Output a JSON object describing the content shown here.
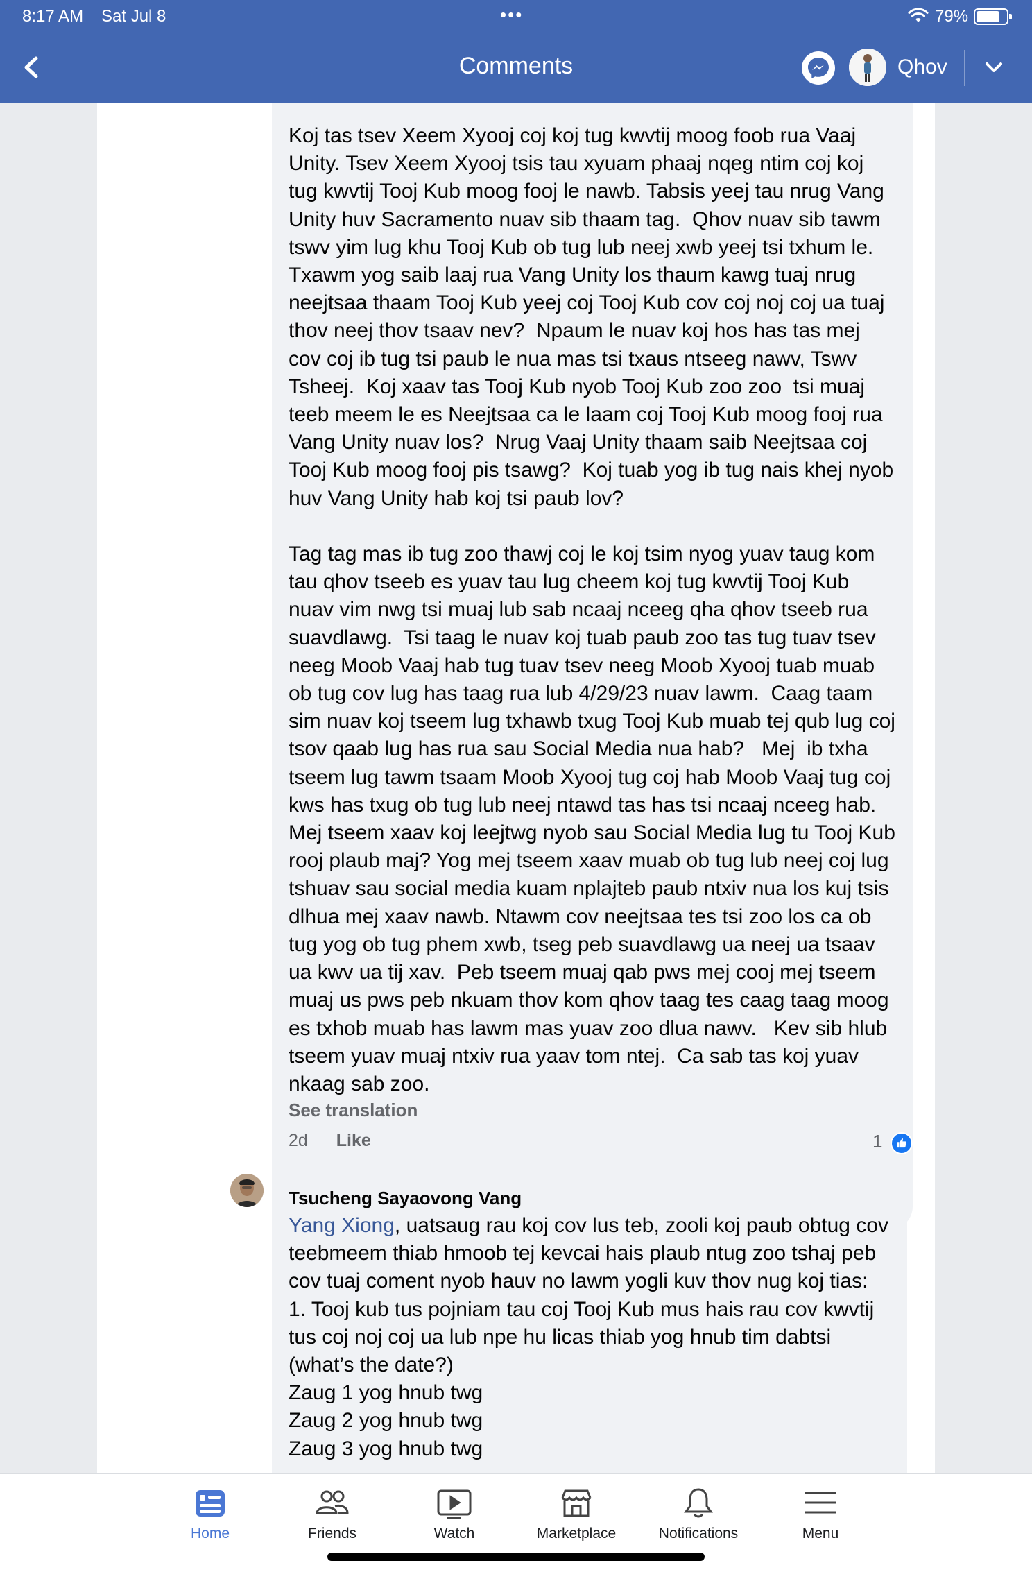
{
  "status_bar": {
    "time": "8:17 AM",
    "date": "Sat Jul 8",
    "battery": "79%",
    "battery_level": 0.79
  },
  "header": {
    "title": "Comments",
    "profile_name": "Qhov",
    "color": "#4267b2"
  },
  "comments": [
    {
      "text": "Koj tas tsev Xeem Xyooj coj koj tug kwvtij moog foob rua Vaaj Unity. Tsev Xeem Xyooj tsis tau xyuam phaaj nqeg ntim coj koj tug kwvtij Tooj Kub moog fooj le nawb. Tabsis yeej tau nrug Vang Unity huv Sacramento nuav sib thaam tag.  Qhov nuav sib tawm tswv yim lug khu Tooj Kub ob tug lub neej xwb yeej tsi txhum le.  Txawm yog saib laaj rua Vang Unity los thaum kawg tuaj nrug neejtsaa thaam Tooj Kub yeej coj Tooj Kub cov coj noj coj ua tuaj thov neej thov tsaav nev?  Npaum le nuav koj hos has tas mej cov coj ib tug tsi paub le nua mas tsi txaus ntseeg nawv, Tswv Tsheej.  Koj xaav tas Tooj Kub nyob Tooj Kub zoo zoo  tsi muaj teeb meem le es Neejtsaa ca le laam coj Tooj Kub moog fooj rua Vang Unity nuav los?  Nrug Vaaj Unity thaam saib Neejtsaa coj Tooj Kub moog fooj pis tsawg?  Koj tuab yog ib tug nais khej nyob huv Vang Unity hab koj tsi paub lov?\n\nTag tag mas ib tug zoo thawj coj le koj tsim nyog yuav taug kom tau qhov tseeb es yuav tau lug cheem koj tug kwvtij Tooj Kub nuav vim nwg tsi muaj lub sab ncaaj nceeg qha qhov tseeb rua suavdlawg.  Tsi taag le nuav koj tuab paub zoo tas tug tuav tsev neeg Moob Vaaj hab tug tuav tsev neeg Moob Xyooj tuab muab ob tug cov lug has taag rua lub 4/29/23 nuav lawm.  Caag taam sim nuav koj tseem lug txhawb txug Tooj Kub muab tej qub lug coj tsov qaab lug has rua sau Social Media nua hab?   Mej  ib txha tseem lug tawm tsaam Moob Xyooj tug coj hab Moob Vaaj tug coj kws has txug ob tug lub neej ntawd tas has tsi ncaaj nceeg hab.  Mej tseem xaav koj leejtwg nyob sau Social Media lug tu Tooj Kub rooj plaub maj? Yog mej tseem xaav muab ob tug lub neej coj lug tshuav sau social media kuam nplajteb paub ntxiv nua los kuj tsis dlhua mej xaav nawb. Ntawm cov neejtsaa tes tsi zoo los ca ob tug yog ob tug phem xwb, tseg peb suavdlawg ua neej ua tsaav ua kwv ua tij xav.  Peb tseem muaj qab pws mej cooj mej tseem muaj us pws peb nkuam thov kom qhov taag tes caag taag moog es txhob muab has lawm mas yuav zoo dlua nawv.   Kev sib hlub tseem yuav muaj ntxiv rua yaav tom ntej.  Ca sab tas koj yuav nkaag sab zoo.",
      "see_translation": "See translation",
      "age": "2d",
      "like_label": "Like",
      "reaction_count": "1"
    },
    {
      "author": "Tsucheng Sayaovong Vang",
      "mention": "Yang Xiong",
      "text": ", uatsaug rau koj cov lus teb, zooli koj paub obtug cov teebmeem thiab hmoob tej kevcai hais plaub ntug zoo tshaj peb cov tuaj coment nyob hauv no lawm yogli kuv thov nug koj tias:\n1. Tooj kub tus pojniam tau coj Tooj Kub mus hais rau cov kwvtij tus coj noj coj ua lub npe hu licas thiab yog hnub tim dabtsi (what’s the date?)\nZaug 1 yog hnub twg\nZaug 2 yog hnub twg\nZaug 3 yog hnub twg"
    }
  ],
  "bottom_nav": [
    {
      "label": "Home",
      "icon": "home-icon",
      "active": true
    },
    {
      "label": "Friends",
      "icon": "friends-icon",
      "active": false
    },
    {
      "label": "Watch",
      "icon": "watch-icon",
      "active": false
    },
    {
      "label": "Marketplace",
      "icon": "marketplace-icon",
      "active": false
    },
    {
      "label": "Notifications",
      "icon": "bell-icon",
      "active": false
    },
    {
      "label": "Menu",
      "icon": "menu-icon",
      "active": false
    }
  ]
}
